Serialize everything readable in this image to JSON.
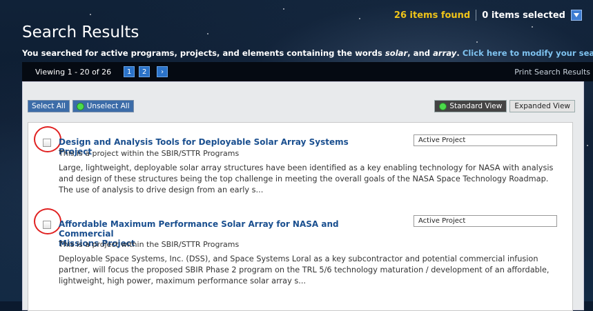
{
  "header": {
    "items_found": "26 items found",
    "items_selected": "0 items selected",
    "title": "Search Results",
    "searched_prefix": "You searched for active programs, projects, and elements containing the words ",
    "term1": "solar",
    "and": ", and ",
    "term2": "array",
    "period": ". ",
    "modify_link": "Click here to modify your search."
  },
  "nav": {
    "viewing": "Viewing 1 - 20 of 26",
    "pages": [
      "1",
      "2"
    ],
    "next": "›",
    "print": "Print Search Results"
  },
  "toolbar": {
    "select_all": "Select All",
    "unselect_all": "Unselect All",
    "standard_view": "Standard View",
    "expanded_view": "Expanded View"
  },
  "results": [
    {
      "title_line1": "Design and Analysis Tools for Deployable Solar Array Systems Project",
      "title_line2": "",
      "subtitle": "This is a project within the SBIR/STTR Programs",
      "status": "Active Project",
      "description": "Large, lightweight, deployable solar array structures have been identified as a key enabling technology for NASA with analysis and design of these structures being the top challenge in meeting the overall goals of the NASA Space Technology Roadmap. The use of analysis to drive design from an early s..."
    },
    {
      "title_line1": "Affordable Maximum Performance Solar Array for NASA and Commercial",
      "title_line2": "Missions Project",
      "subtitle": "This is a project within the SBIR/STTR Programs",
      "status": "Active Project",
      "description": "Deployable Space Systems, Inc. (DSS), and Space Systems Loral as a key subcontractor and potential commercial infusion partner, will focus the proposed SBIR Phase 2 program on the TRL 5/6 technology maturation / development of an affordable, lightweight, high power, maximum performance solar array s..."
    }
  ],
  "colors": {
    "accent_blue": "#2b73c9",
    "found_yellow": "#f0c419",
    "title_link": "#1a4f8f",
    "annotation_red": "#e02020"
  }
}
